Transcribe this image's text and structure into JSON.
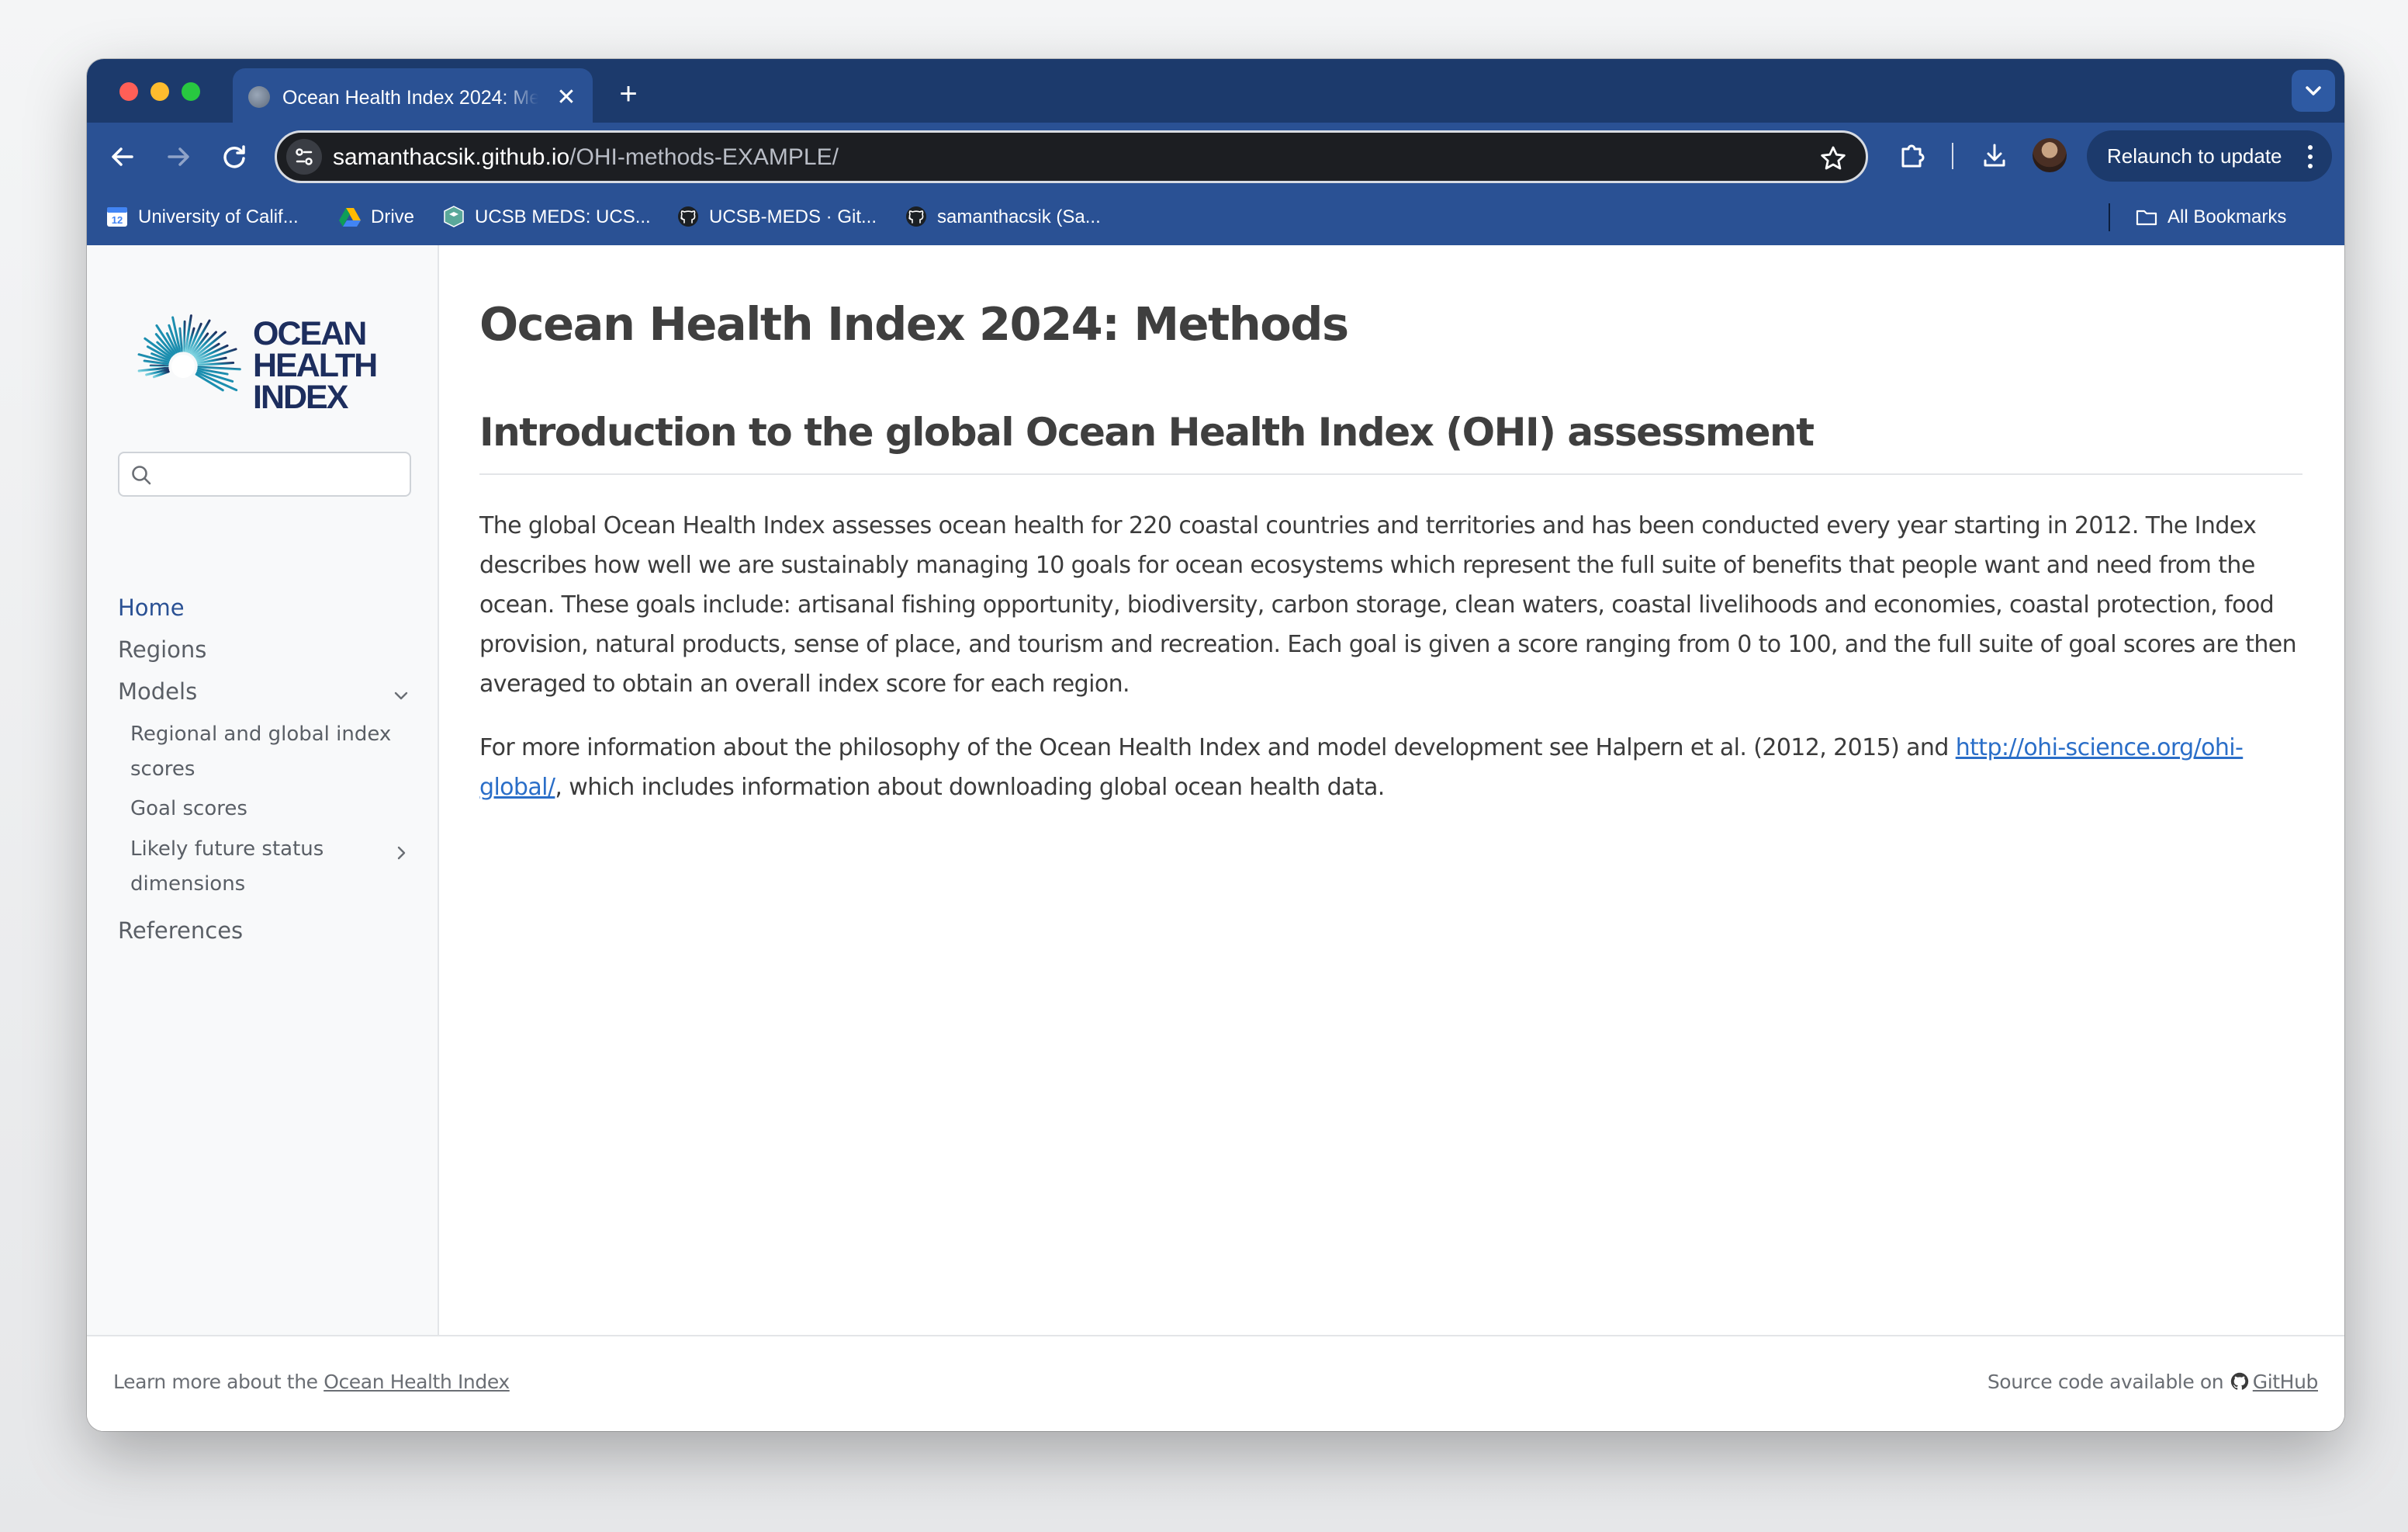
{
  "browser": {
    "tab_title": "Ocean Health Index 2024: Methods",
    "new_tab_symbol": "+",
    "tab_close_symbol": "✕",
    "url_host": "samanthacsik.github.io",
    "url_path": "/OHI-methods-EXAMPLE/",
    "relaunch_label": "Relaunch to update",
    "icons": {
      "back": "arrow-left-icon",
      "forward": "arrow-right-icon",
      "reload": "reload-icon",
      "site_info": "tune-icon",
      "bookmark_star": "star-icon",
      "extensions": "puzzle-icon",
      "downloads": "download-icon",
      "profile": "avatar",
      "menu": "kebab-menu-icon",
      "tab_search": "chevron-down-icon"
    },
    "colors": {
      "frame": "#1c3a6c",
      "toolbar": "#2a5194",
      "omnibox": "#1c1e22"
    }
  },
  "bookmarks": [
    {
      "label": "University of Calif...",
      "icon": "calendar-icon"
    },
    {
      "label": "Drive",
      "icon": "google-drive-icon"
    },
    {
      "label": "UCSB MEDS: UCS...",
      "icon": "meds-icon"
    },
    {
      "label": "UCSB-MEDS · Git...",
      "icon": "github-icon"
    },
    {
      "label": "samanthacsik (Sa...",
      "icon": "github-icon"
    }
  ],
  "all_bookmarks_label": "All Bookmarks",
  "sidebar": {
    "logo_text": [
      "OCEAN",
      "HEALTH",
      "INDEX"
    ],
    "search_placeholder": "",
    "nav": [
      {
        "label": "Home",
        "active": true
      },
      {
        "label": "Regions"
      },
      {
        "label": "Models",
        "expanded": true
      }
    ],
    "subnav": [
      {
        "label": "Regional and global index scores"
      },
      {
        "label": "Goal scores"
      },
      {
        "label": "Likely future status dimensions",
        "has_children": true
      }
    ],
    "references_label": "References",
    "accent_color": "#2a5194"
  },
  "main": {
    "title": "Ocean Health Index 2024: Methods",
    "section_heading": "Introduction to the global Ocean Health Index (OHI) assessment",
    "paragraph1": "The global Ocean Health Index assesses ocean health for 220 coastal countries and territories and has been conducted every year starting in 2012. The Index describes how well we are sustainably managing 10 goals for ocean ecosystems which represent the full suite of benefits that people want and need from the ocean. These goals include: artisanal fishing opportunity, biodiversity, carbon storage, clean waters, coastal livelihoods and economies, coastal protection, food provision, natural products, sense of place, and tourism and recreation. Each goal is given a score ranging from 0 to 100, and the full suite of goal scores are then averaged to obtain an overall index score for each region.",
    "paragraph2_before": "For more information about the philosophy of the Ocean Health Index and model development see Halpern et al. (2012, 2015) and ",
    "paragraph2_link": "http://ohi-science.org/ohi-global/",
    "paragraph2_after": ", which includes information about downloading global ocean health data.",
    "link_color": "#2a6ec8"
  },
  "footer": {
    "left_text": "Learn more about the ",
    "left_link": "Ocean Health Index",
    "right_text": "Source code available on ",
    "right_link": "GitHub"
  }
}
